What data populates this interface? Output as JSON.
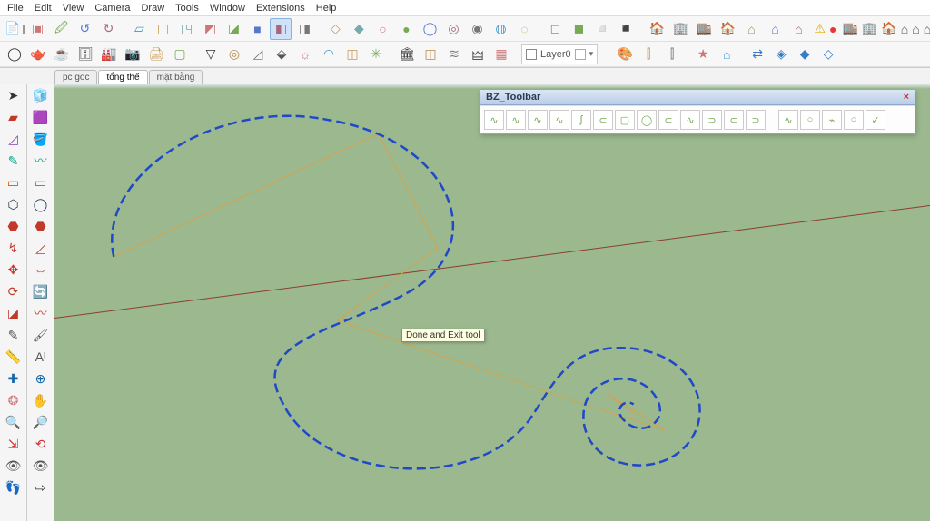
{
  "menu": {
    "file": "File",
    "edit": "Edit",
    "view": "View",
    "camera": "Camera",
    "draw": "Draw",
    "tools": "Tools",
    "window": "Window",
    "extensions": "Extensions",
    "help": "Help"
  },
  "scene_tabs": {
    "pcgoc": "pc goc",
    "tongthe": "tổng thế",
    "matbang": "mặt bằng"
  },
  "layer": {
    "label": "Layer0",
    "check": ""
  },
  "tooltip": "Done and Exit tool",
  "bz_panel": {
    "title": "BZ_Toolbar",
    "close": "×"
  },
  "top_row1_glyphs": [
    "▣",
    "🖉",
    "↺",
    "↻",
    "",
    "▱",
    "◫",
    "◳",
    "◩",
    "◪",
    "■",
    "◧",
    "◨",
    "",
    "◇",
    "◆",
    "○",
    "●",
    "◯",
    "◎",
    "◉",
    "◍",
    "◌",
    "",
    "◻",
    "◼",
    "◽",
    "◾",
    "",
    "🏠",
    "🏢",
    "🏬",
    "🏠",
    "⌂",
    "⌂",
    "⌂"
  ],
  "top_row2_glyphs": [
    "◯",
    "🫖",
    "☕",
    "🗄",
    "🏭",
    "📷",
    "🖨",
    "▢",
    "",
    "▽",
    "◎",
    "◿",
    "⬙",
    "☼",
    "◠",
    "◫",
    "✳",
    "",
    "🏛",
    "◫",
    "≋",
    "🜲",
    "▦",
    "",
    "✓",
    "",
    "",
    "🎨",
    "⫿",
    "⫿",
    "",
    "★",
    "⌂",
    "",
    "⇄",
    "◈",
    "◆",
    "◇"
  ],
  "left_col1": [
    "➤",
    "▰",
    "◿",
    "✎",
    "▭",
    "⬡",
    "⬣",
    "↯",
    "✥",
    "⟳",
    "◪",
    "✎",
    "📏",
    "✚",
    "❂",
    "🔍",
    "⇲",
    "👁",
    "👣"
  ],
  "left_col2": [
    "🧊",
    "🟪",
    "🪣",
    "〰",
    "▭",
    "◯",
    "⬣",
    "◿",
    "⇔",
    "🔄",
    "〰",
    "🖌",
    "Aᴵ",
    "⊕",
    "✋",
    "🔎",
    "⟲",
    "👁",
    "⇨"
  ],
  "bz_glyphs": [
    "∿",
    "∿",
    "∿",
    "∿",
    "ʃ",
    "⊂",
    "▢",
    "◯",
    "⊂",
    "∿",
    "⊃",
    "⊂",
    "⊃",
    "",
    "∿",
    "○",
    "⌁",
    "○",
    "✓"
  ],
  "colors": {
    "viewport": "#9bb88e",
    "curve": "#1f49c7",
    "axis": "#8d3e2e",
    "helper": "#d8a24a"
  }
}
